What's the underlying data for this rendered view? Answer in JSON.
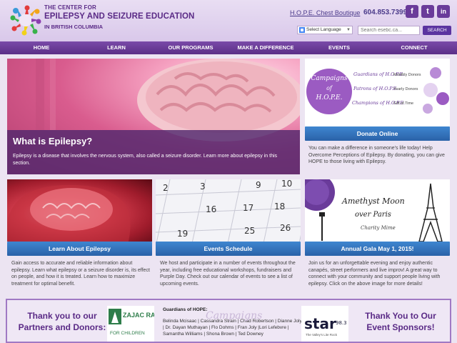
{
  "header": {
    "org_line1": "THE CENTER FOR",
    "org_line2": "EPILEPSY AND SEIZURE EDUCATION",
    "org_line3": "IN BRITISH COLUMBIA",
    "boutique_link": "H.O.P.E. Chest Boutique",
    "phone": "604.853.7399",
    "social": [
      "f",
      "t",
      "in"
    ],
    "language_select": "Select Language",
    "search_placeholder": "Search esebc.ca...",
    "search_button": "SEARCH"
  },
  "nav": {
    "items": [
      "HOME",
      "LEARN",
      "OUR PROGRAMS",
      "MAKE A DIFFERENCE",
      "EVENTS",
      "CONNECT"
    ]
  },
  "hero": {
    "title": "What is Epilepsy?",
    "text": "Epilepsy is a disease that involves the nervous system, also called a seizure disorder. Learn more about epilepsy in this section."
  },
  "campaign": {
    "title_line1": "Campaigns",
    "title_line2": "of",
    "title_line3": "H.O.P.E.",
    "rows": [
      {
        "label": "Guardians of H.O.P.E.",
        "desc": "Monthly Donors"
      },
      {
        "label": "Patrons of H.O.P.E.",
        "desc": "Yearly Donors"
      },
      {
        "label": "Champions of H.O.P.E.",
        "desc": "Gift of Time"
      }
    ],
    "button": "Donate Online",
    "text": "You can make a difference in someone's life today! Help Overcome Perceptions of Epilepsy. By donating, you can give HOPE to those living with Epilepsy."
  },
  "cards": [
    {
      "button": "Learn About Epilepsy",
      "text": "Gain access to accurate and reliable information about epilepsy. Learn what epilepsy or a seizure disorder is, its effect on people, and how it is treated. Learn how to maximize treatment for optimal benefit."
    },
    {
      "button": "Events Schedule",
      "text": "We host and participate in a number of events throughout the year, including free educational workshops, fundraisers and Purple Day. Check out our calendar of events to see a list of upcoming events."
    },
    {
      "button": "Annual Gala May 1, 2015!",
      "text": "Join us for an unforgettable evening and enjoy authentic canapés, street performers and live improv! A great way to connect with your community and support people living with epilepsy. Click on the above image for more details!"
    }
  ],
  "calendar_numbers": [
    "2",
    "3",
    "9",
    "10",
    "16",
    "17",
    "18",
    "19",
    "25",
    "26"
  ],
  "gala": {
    "line1": "Amethyst Moon",
    "line2": "over Paris",
    "line3": "Charity Mime"
  },
  "band": {
    "left_title": "Thank you to our Partners and Donors:",
    "zajac_name": "ZAJAC RANCH",
    "zajac_sub": "FOR CHILDREN",
    "guardians_title": "Guardians of HOPE:",
    "guardians_names": "Belinda Mcisaac | Cassandra Strain | Chad Robertson | Dianne Joly | Dr. Dayan Muthayan | Flo Dohms | Fran Joly |Lori Lefebvre | Samantha Williams | Shona Brown | Ted Downey",
    "watermark": "Campaigns",
    "star_text": "star",
    "star_freq": "98.3",
    "star_sub": "The Valley's Lite Rock",
    "right_title": "Thank You to Our Event Sponsors!"
  },
  "colors": {
    "brand_purple": "#5a2a86",
    "nav_purple": "#6a3b9a",
    "button_blue": "#2f6fb8",
    "background": "#ece4f2"
  }
}
